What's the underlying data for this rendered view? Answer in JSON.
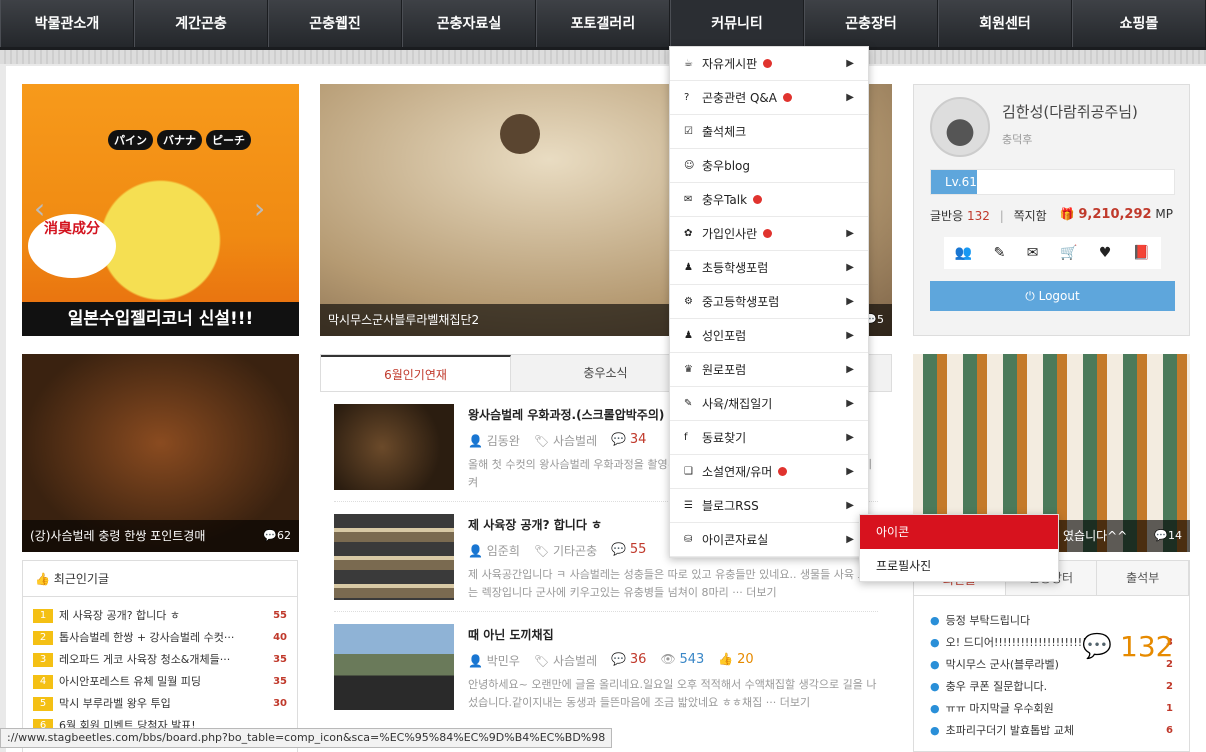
{
  "nav": [
    "박물관소개",
    "계간곤충",
    "곤충웹진",
    "곤충자료실",
    "포토갤러리",
    "커뮤니티",
    "곤충장터",
    "회원센터",
    "쇼핑몰"
  ],
  "tiles": {
    "t1": {
      "banner": "일본수입젤리코너 신설!!!",
      "badge": "消臭成分",
      "fruits": [
        "パイン",
        "バナナ",
        "ピーチ"
      ]
    },
    "t2": {
      "caption": "막시무스군사블루라벨채집단2",
      "count": "5"
    },
    "t3": {
      "caption": "(강)사슴벌레 충령 한쌍 포인트경매",
      "count": "62"
    },
    "t4": {
      "caption": "였습니다^^",
      "count": "14"
    }
  },
  "profile": {
    "name": "김한성(다람쥐공주님)",
    "grade": "충덕후",
    "level": "Lv.61",
    "level_pct": 19,
    "posts_label": "글반응",
    "posts_count": "132",
    "memo_label": "쪽지함",
    "points": "9,210,292",
    "points_unit": "MP",
    "logout": "Logout"
  },
  "center_tabs": [
    "6월인기연재",
    "충우소식"
  ],
  "posts": [
    {
      "title": "왕사슴벌레 우화과정.(스크롤압박주의)",
      "author": "김동완",
      "category": "사슴벌레",
      "comments": "34",
      "views": "",
      "likes": "",
      "excerpt": "올해 첫 수컷의 왕사슴벌레 우화과정을 촬영~ 다~오랜만에 왕사슴벌레의 우화과정을 지켜"
    },
    {
      "title": "제 사육장 공개? 합니다 ㅎ",
      "author": "임준희",
      "category": "기타곤충",
      "comments": "55",
      "views": "",
      "likes": "",
      "excerpt": "제 사육공간입니다 ㅋ 사슴벌레는 성충들은 따로 있고 유충들만 있네요.. 생물들 사육 고있는 렉장입니다 군사에 키우고있는 유충병들 넘쳐이 8마리 ··· 더보기"
    },
    {
      "title": "때 아닌 도끼채집",
      "author": "박민우",
      "category": "사슴벌레",
      "comments": "36",
      "views": "543",
      "likes": "20",
      "excerpt": "안녕하세요~ 오랜만에 글을 올리네요.일요일 오후 적적해서 수액채집할 생각으로 길을 나섰습니다.같이지내는 동생과 들뜬마음에 조금 밟았네요 ㅎㅎ채집 ··· 더보기"
    }
  ],
  "popular": {
    "title": "최근인기글",
    "items": [
      {
        "num": "1",
        "text": "제 사육장 공개? 합니다 ㅎ",
        "count": "55"
      },
      {
        "num": "2",
        "text": "톱사슴벌레 한쌍 + 강사슴벌레 수컷···",
        "count": "40"
      },
      {
        "num": "3",
        "text": "레오파드 게코 사육장 청소&개체들···",
        "count": "35"
      },
      {
        "num": "4",
        "text": "아시안포레스트 유체 밀월 피딩",
        "count": "35"
      },
      {
        "num": "5",
        "text": "막시 부루라벨 왕우 투입",
        "count": "30"
      },
      {
        "num": "6",
        "text": "6월 회원 미벤트 당첨자 발표!",
        "count": ""
      }
    ]
  },
  "dropdown": [
    {
      "icon": "☕",
      "label": "자유게시판",
      "dot": true,
      "chevron": true
    },
    {
      "icon": "?",
      "label": "곤충관련 Q&A",
      "dot": true,
      "chevron": true
    },
    {
      "icon": "☑",
      "label": "출석체크",
      "dot": false,
      "chevron": false
    },
    {
      "icon": "☺",
      "label": "충우blog",
      "dot": false,
      "chevron": false
    },
    {
      "icon": "✉",
      "label": "충우Talk",
      "dot": true,
      "chevron": false
    },
    {
      "icon": "✿",
      "label": "가입인사란",
      "dot": true,
      "chevron": true
    },
    {
      "icon": "♟",
      "label": "초등학생포럼",
      "dot": false,
      "chevron": true
    },
    {
      "icon": "⚙",
      "label": "중고등학생포럼",
      "dot": false,
      "chevron": true
    },
    {
      "icon": "♟",
      "label": "성인포럼",
      "dot": false,
      "chevron": true
    },
    {
      "icon": "♛",
      "label": "원로포럼",
      "dot": false,
      "chevron": true
    },
    {
      "icon": "✎",
      "label": "사육/채집일기",
      "dot": false,
      "chevron": true
    },
    {
      "icon": "f",
      "label": "동료찾기",
      "dot": false,
      "chevron": true
    },
    {
      "icon": "❑",
      "label": "소설연재/유머",
      "dot": true,
      "chevron": true
    },
    {
      "icon": "☰",
      "label": "블로그RSS",
      "dot": false,
      "chevron": true
    },
    {
      "icon": "⛁",
      "label": "아이콘자료실",
      "dot": false,
      "chevron": true
    }
  ],
  "submenu": [
    "아이콘",
    "프로필사진"
  ],
  "right_tabs": [
    "최신글",
    "곤충장터",
    "출석부"
  ],
  "right_list": [
    {
      "text": "등정 부탁드립니다",
      "count": ""
    },
    {
      "text": "오! 드디어!!!!!!!!!!!!!!!!!!!!!!!!!!",
      "count": "3"
    },
    {
      "text": "막시무스 군사(블루라벨)",
      "count": "2"
    },
    {
      "text": "충우 쿠폰 질문합니다.",
      "count": "2"
    },
    {
      "text": "ㅠㅠ 마지막글 우수회원",
      "count": "1"
    },
    {
      "text": "초파리구더기 발효톱밥 교체",
      "count": "6"
    }
  ],
  "chat_count": "132",
  "status_url": "://www.stagbeetles.com/bbs/board.php?bo_table=comp_icon&sca=%EC%95%84%EC%9D%B4%EC%BD%98"
}
